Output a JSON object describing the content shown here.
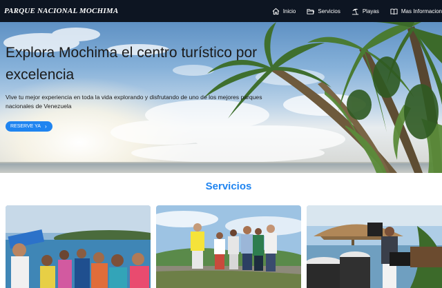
{
  "brand": "PARQUE NACIONAL MOCHIMA",
  "nav": {
    "items": [
      {
        "label": "Inicio",
        "icon": "home-icon"
      },
      {
        "label": "Servicios",
        "icon": "folder-icon"
      },
      {
        "label": "Playas",
        "icon": "umbrella-icon"
      },
      {
        "label": "Mas Informacion",
        "icon": "book-icon"
      }
    ]
  },
  "hero": {
    "title": "Explora Mochima el centro turístico por excelencia",
    "subtitle": "Vive tu mejor experiencia en toda la vida explorando y disfrutando de uno de los mejores parques nacionales de Venezuela",
    "button_label": "RESERVE YA"
  },
  "services": {
    "title": "Servicios"
  },
  "colors": {
    "navbar": "#0d1522",
    "accent": "#1f84f0"
  }
}
